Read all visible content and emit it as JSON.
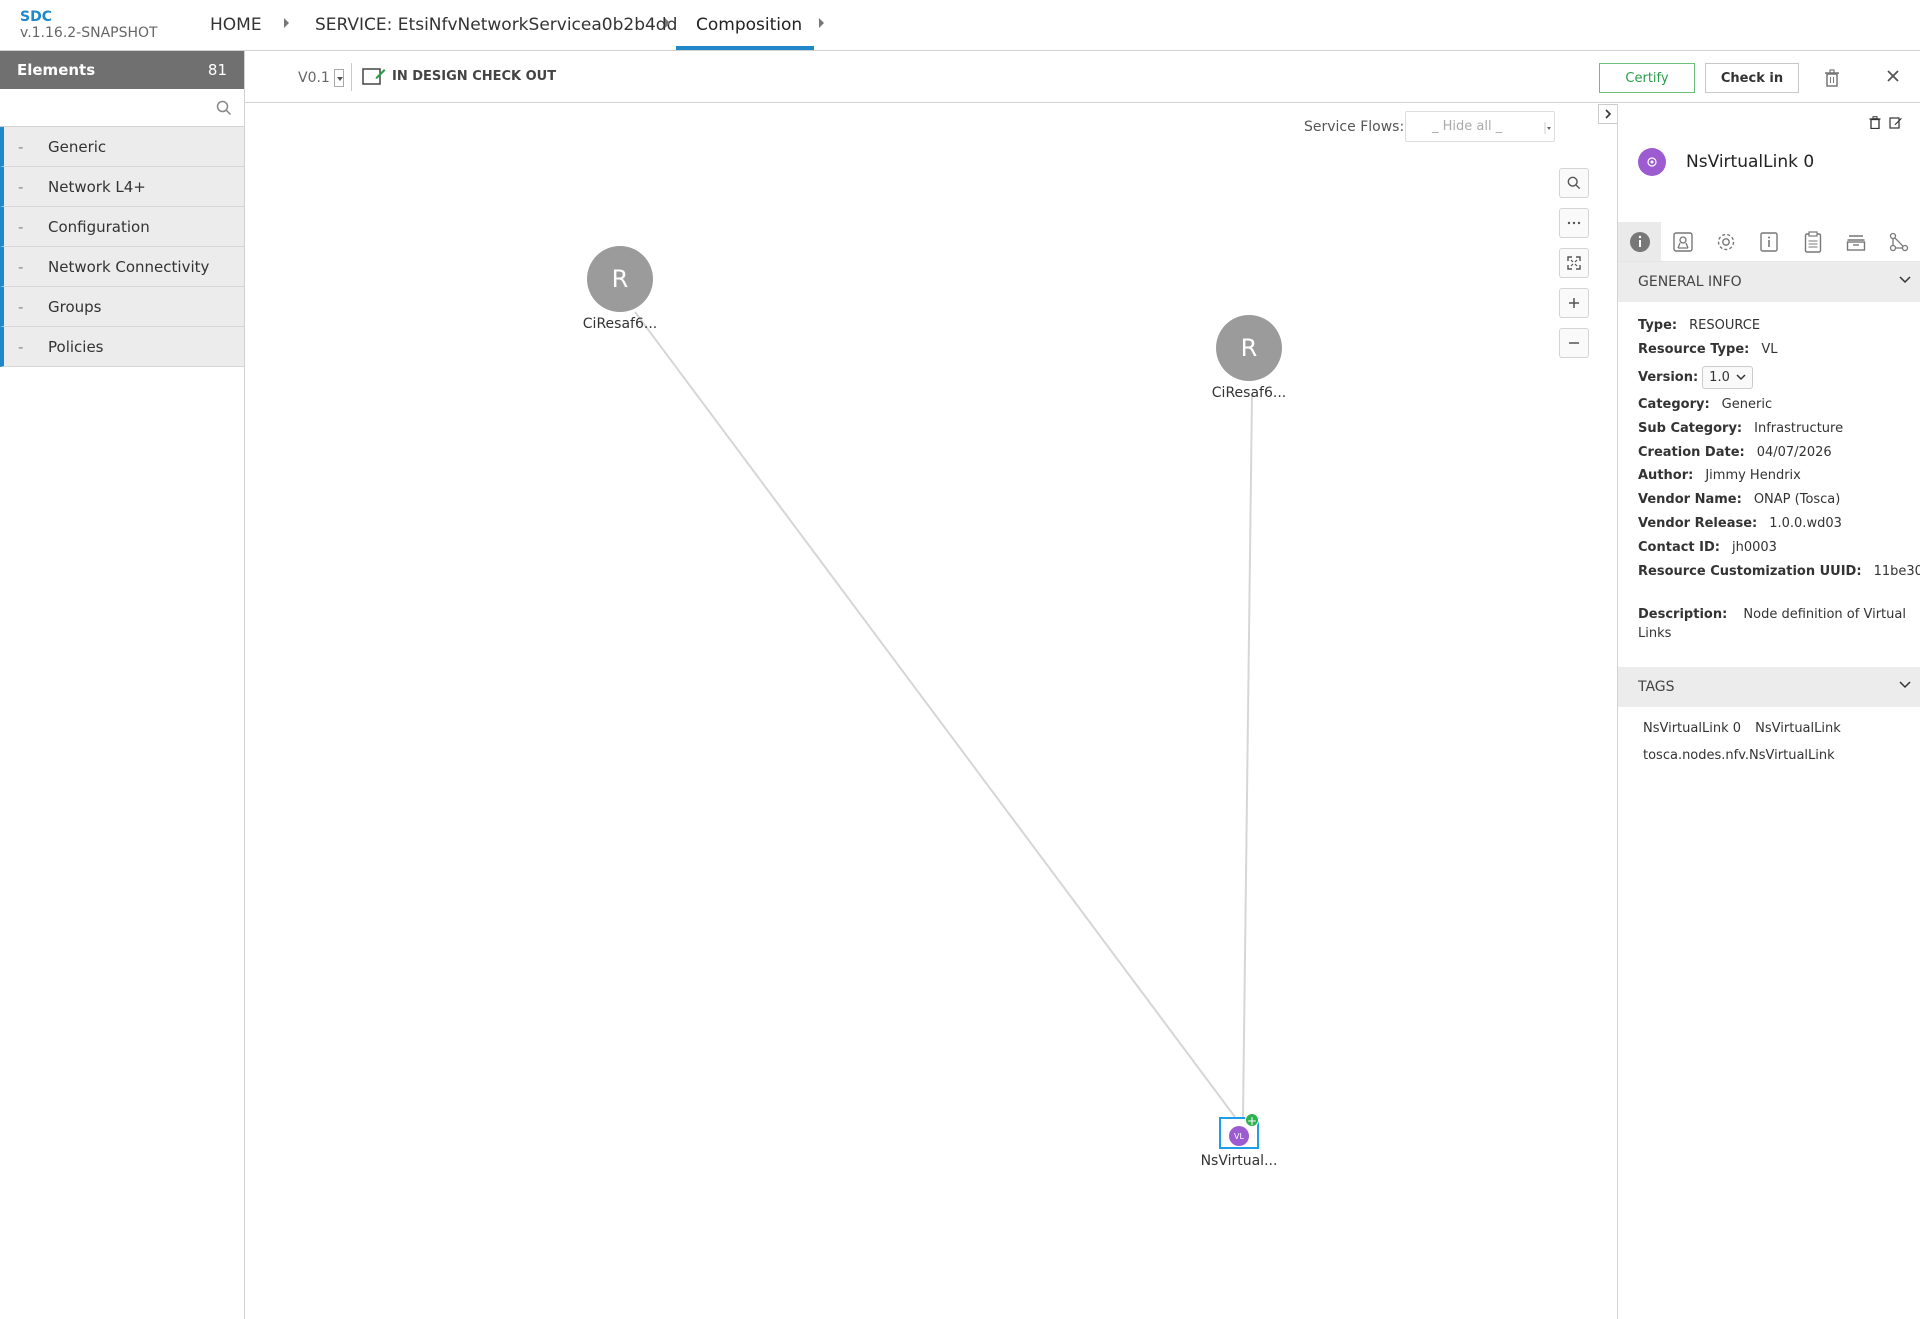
{
  "app": {
    "name": "SDC",
    "version": "v.1.16.2-SNAPSHOT"
  },
  "breadcrumb": {
    "home": "HOME",
    "service": "SERVICE: EtsiNfvNetworkServicea0b2b4dd",
    "current": "Composition"
  },
  "left_panel": {
    "title": "Elements",
    "count": "81",
    "search_placeholder": "",
    "categories": [
      {
        "label": "Generic"
      },
      {
        "label": "Network L4+"
      },
      {
        "label": "Configuration"
      },
      {
        "label": "Network Connectivity"
      },
      {
        "label": "Groups"
      },
      {
        "label": "Policies"
      }
    ]
  },
  "toolbar": {
    "version": "V0.1",
    "status": "IN DESIGN CHECK OUT",
    "certify": "Certify",
    "checkin": "Check in"
  },
  "canvas": {
    "service_flows_label": "Service Flows:",
    "service_flows_value": "_ Hide all _",
    "nodes": [
      {
        "initial": "R",
        "label": "CiResaf6..."
      },
      {
        "initial": "R",
        "label": "CiResaf6..."
      },
      {
        "badge": "VL",
        "label": "NsVirtual..."
      }
    ],
    "zoom_controls": [
      "search-icon",
      "more-icon",
      "fit-icon",
      "zoom-in-icon",
      "zoom-out-icon"
    ]
  },
  "right_panel": {
    "title": "NsVirtualLink 0",
    "general_info_title": "GENERAL INFO",
    "info": {
      "type_k": "Type:",
      "type_v": "RESOURCE",
      "rtype_k": "Resource Type:",
      "rtype_v": "VL",
      "version_k": "Version:",
      "version_v": "1.0",
      "category_k": "Category:",
      "category_v": "Generic",
      "subcat_k": "Sub Category:",
      "subcat_v": "Infrastructure",
      "cdate_k": "Creation Date:",
      "cdate_v": "04/07/2026",
      "author_k": "Author:",
      "author_v": "Jimmy Hendrix",
      "vname_k": "Vendor Name:",
      "vname_v": "ONAP (Tosca)",
      "vrel_k": "Vendor Release:",
      "vrel_v": "1.0.0.wd03",
      "contact_k": "Contact ID:",
      "contact_v": "jh0003",
      "uuid_k": "Resource Customization UUID:",
      "uuid_v": "11be30...",
      "desc_k": "Description:",
      "desc_v": "Node definition of Virtual Links"
    },
    "tags_title": "TAGS",
    "tags": [
      "NsVirtualLink 0",
      "NsVirtualLink",
      "tosca.nodes.nfv.NsVirtualLink"
    ]
  },
  "colors": {
    "accent": "#1e88c9",
    "certify": "#2a9d4a",
    "vl_purple": "#9c5bd0",
    "node_gray": "#9b9b9b"
  }
}
